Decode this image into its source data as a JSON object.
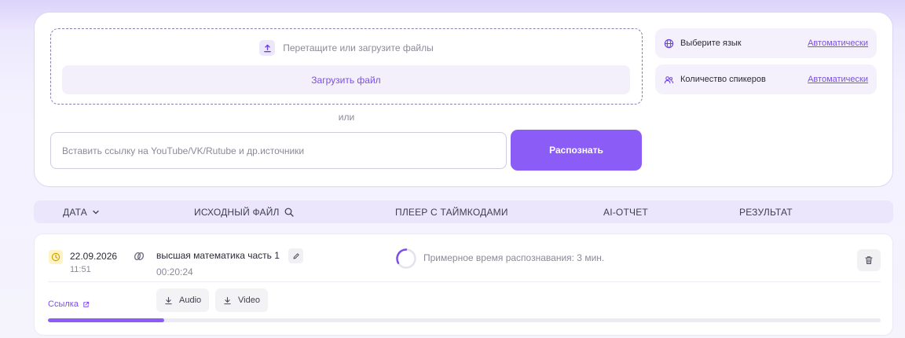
{
  "upload": {
    "drop_hint": "Перетащите или загрузите файлы",
    "upload_button": "Загрузить файл",
    "or_text": "или",
    "url_placeholder": "Вставить ссылку на YouTube/VK/Rutube и др.источники",
    "url_value": "",
    "recognize_button": "Распознать"
  },
  "options": [
    {
      "label": "Выберите язык",
      "value": "Автоматически",
      "icon": "globe-icon"
    },
    {
      "label": "Количество спикеров",
      "value": "Автоматически",
      "icon": "users-icon"
    }
  ],
  "table": {
    "columns": [
      {
        "label": "ДАТА",
        "icon": "chevron-down-icon"
      },
      {
        "label": "ИСХОДНЫЙ ФАЙЛ",
        "icon": "search-icon"
      },
      {
        "label": "ПЛЕЕР С ТАЙМКОДАМИ"
      },
      {
        "label": "AI-ОТЧЕТ"
      },
      {
        "label": "РЕЗУЛЬТАТ"
      }
    ],
    "rows": [
      {
        "date": "22.09.2026",
        "time": "11:51",
        "file_name": "высшая математика часть 1",
        "duration": "00:20:24",
        "status": "Примерное время распознавания: 3 мин.",
        "link_label": "Ссылка",
        "audio_label": "Audio",
        "video_label": "Video",
        "progress": 0.14
      }
    ]
  },
  "colors": {
    "accent": "#8b5cf6",
    "accent_text": "#7c4ee8",
    "clock_badge": "#fdf3c4"
  }
}
